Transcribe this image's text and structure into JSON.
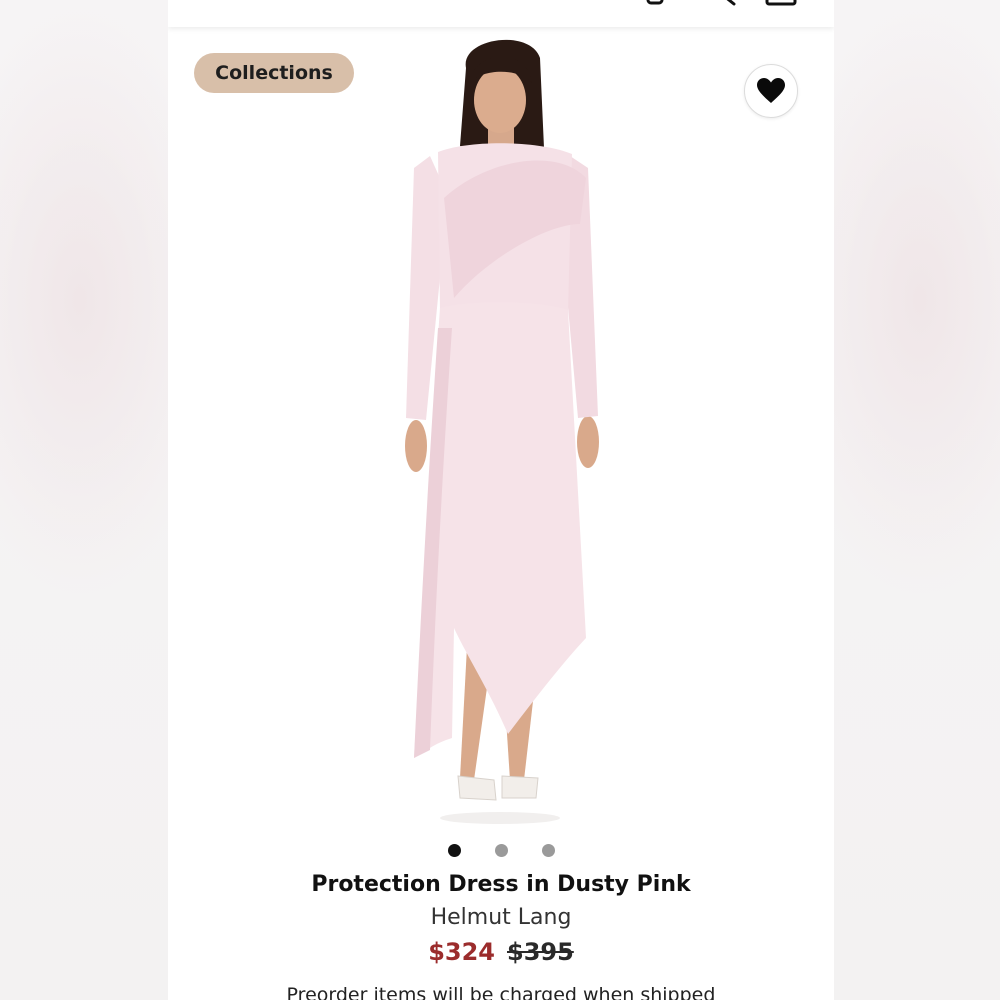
{
  "header": {
    "icons": [
      "account-icon",
      "search-icon",
      "bag-icon"
    ]
  },
  "badge": {
    "label": "Collections"
  },
  "favorite": {
    "icon": "heart-icon",
    "active": true
  },
  "gallery": {
    "image_count": 3,
    "active_index": 0
  },
  "product": {
    "title": "Protection Dress in Dusty Pink",
    "brand": "Helmut Lang",
    "sale_price": "$324",
    "original_price": "$395",
    "note": "Preorder items will be charged when shipped"
  },
  "colors": {
    "badge_bg": "#d8bfa9",
    "sale_price": "#9b2c2c",
    "dress": "#f3dde3"
  }
}
